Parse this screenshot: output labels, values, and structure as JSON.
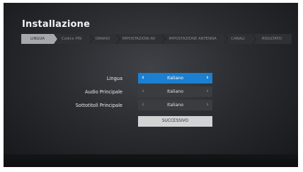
{
  "header": {
    "title": "Installazione"
  },
  "steps": [
    {
      "label": "LINGUA",
      "active": true
    },
    {
      "label": "Codice PIN",
      "active": false
    },
    {
      "label": "ORARIO",
      "active": false
    },
    {
      "label": "IMPOSTAZIONI AV",
      "active": false
    },
    {
      "label": "IMPOSTAZIONE ANTENNA",
      "active": false
    },
    {
      "label": "CANALI",
      "active": false
    },
    {
      "label": "RISULTATO",
      "active": false
    }
  ],
  "settings": {
    "language": {
      "label": "Lingua",
      "value": "Italiano",
      "prev_icon": "chevron-left-icon",
      "next_icon": "chevron-right-icon"
    },
    "audio": {
      "label": "Audio Principale",
      "value": "Italiano",
      "prev_icon": "chevron-left-icon",
      "next_icon": "chevron-right-icon"
    },
    "subtitles": {
      "label": "Sottotitoli Principale",
      "value": "Italiano",
      "prev_icon": "chevron-left-icon",
      "next_icon": "chevron-right-icon"
    }
  },
  "next_button": {
    "label": "SUCCESSIVO"
  },
  "colors": {
    "focus_accent": "#1c7fd0",
    "active_step": "#a7a8aa",
    "button_background": "#d2d3d5"
  }
}
